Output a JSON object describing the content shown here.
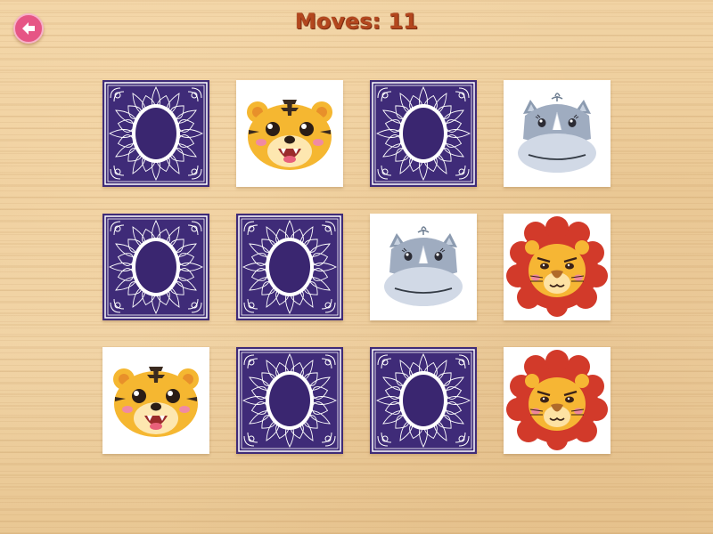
{
  "header": {
    "moves_text": "Moves: 11",
    "back_icon": "back-arrow-icon"
  },
  "colors": {
    "card_back": "#3f2b78",
    "card_back_center": "#3a2670",
    "back_button": "#e65585",
    "moves_text": "#b3471e"
  },
  "board": {
    "rows": 3,
    "columns": 4,
    "cards": [
      {
        "row": 1,
        "col": 1,
        "state": "face-down",
        "animal": ""
      },
      {
        "row": 1,
        "col": 2,
        "state": "face-up",
        "animal": "tiger"
      },
      {
        "row": 1,
        "col": 3,
        "state": "face-down",
        "animal": ""
      },
      {
        "row": 1,
        "col": 4,
        "state": "face-up",
        "animal": "rhino"
      },
      {
        "row": 2,
        "col": 1,
        "state": "face-down",
        "animal": ""
      },
      {
        "row": 2,
        "col": 2,
        "state": "face-down",
        "animal": ""
      },
      {
        "row": 2,
        "col": 3,
        "state": "face-up",
        "animal": "rhino"
      },
      {
        "row": 2,
        "col": 4,
        "state": "face-up",
        "animal": "lion"
      },
      {
        "row": 3,
        "col": 1,
        "state": "face-up",
        "animal": "tiger"
      },
      {
        "row": 3,
        "col": 2,
        "state": "face-down",
        "animal": ""
      },
      {
        "row": 3,
        "col": 3,
        "state": "face-down",
        "animal": ""
      },
      {
        "row": 3,
        "col": 4,
        "state": "face-up",
        "animal": "lion"
      }
    ]
  }
}
